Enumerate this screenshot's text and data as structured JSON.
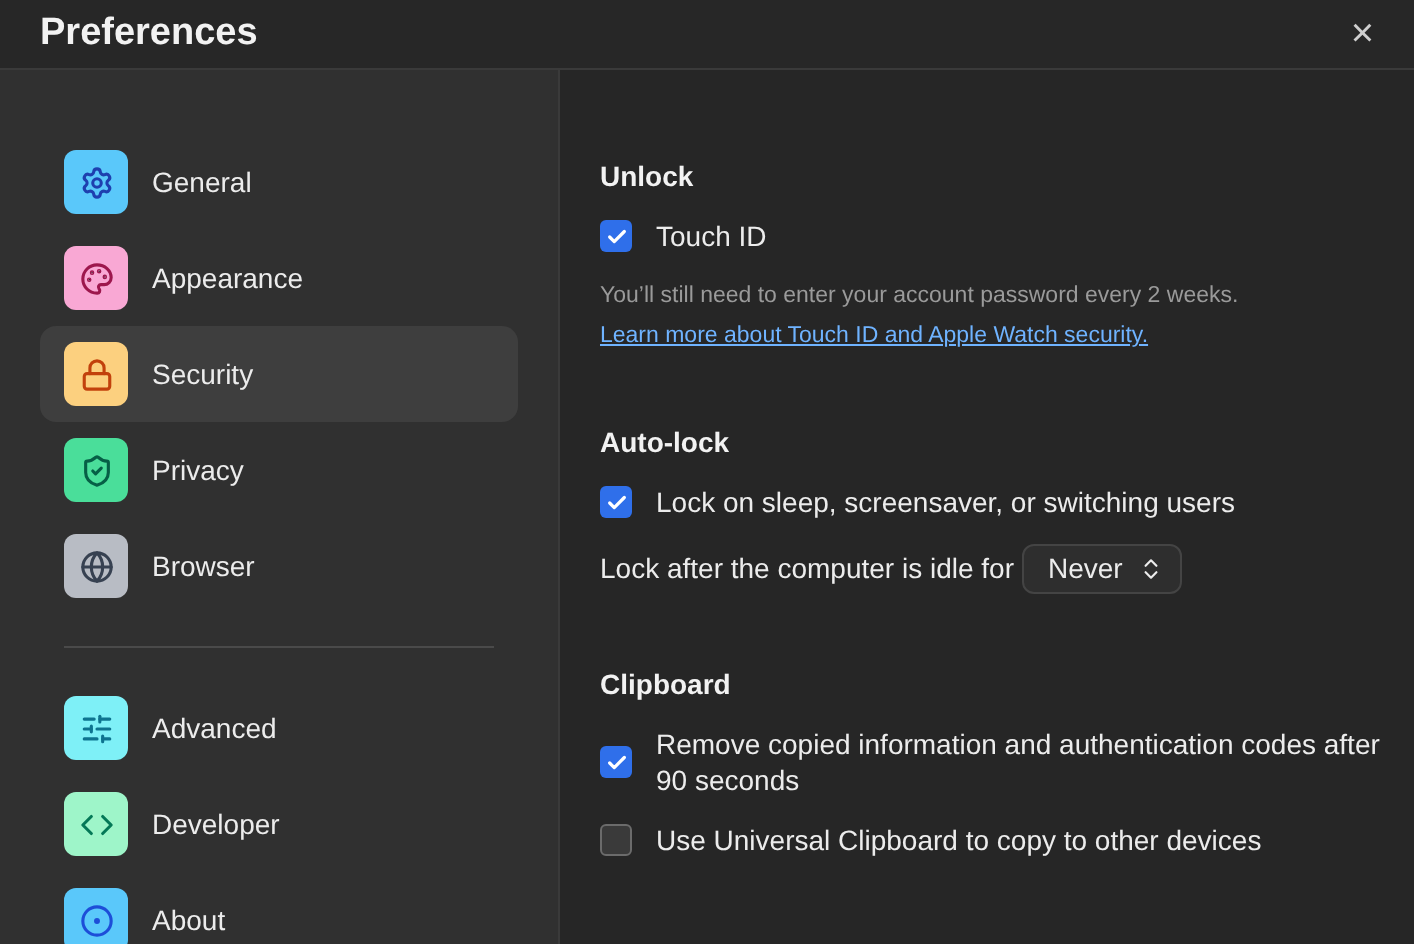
{
  "window": {
    "title": "Preferences",
    "close": "×"
  },
  "sidebar": {
    "groups": [
      {
        "items": [
          {
            "label": "General",
            "selected": false,
            "color": "#5ac8fa"
          },
          {
            "label": "Appearance",
            "selected": false,
            "color": "#f9a8d4"
          },
          {
            "label": "Security",
            "selected": true,
            "color": "#fcd07f"
          },
          {
            "label": "Privacy",
            "selected": false,
            "color": "#4ade9a"
          },
          {
            "label": "Browser",
            "selected": false,
            "color": "#b8bcc4"
          }
        ]
      },
      {
        "items": [
          {
            "label": "Advanced",
            "selected": false,
            "color": "#7ef0f7"
          },
          {
            "label": "Developer",
            "selected": false,
            "color": "#9ef5c9"
          },
          {
            "label": "About",
            "selected": false,
            "color": "#5ac8fa"
          }
        ]
      }
    ]
  },
  "sections": [
    {
      "title": "Unlock",
      "rows": [
        {
          "kind": "checkbox",
          "label": "Touch ID",
          "checked": true
        },
        {
          "kind": "note",
          "text": "You’ll still need to enter your account password every 2 weeks."
        },
        {
          "kind": "link",
          "text": "Learn more about Touch ID and Apple Watch security."
        }
      ]
    },
    {
      "title": "Auto-lock",
      "rows": [
        {
          "kind": "checkbox",
          "label": "Lock on sleep, screensaver, or switching users",
          "checked": true
        },
        {
          "kind": "select",
          "label": "Lock after the computer is idle for",
          "value": "Never"
        }
      ]
    },
    {
      "title": "Clipboard",
      "rows": [
        {
          "kind": "checkbox",
          "label": "Remove copied information and authentication codes after 90 seconds",
          "checked": true
        },
        {
          "kind": "checkbox",
          "label": "Use Universal Clipboard to copy to other devices",
          "checked": false
        }
      ]
    }
  ]
}
